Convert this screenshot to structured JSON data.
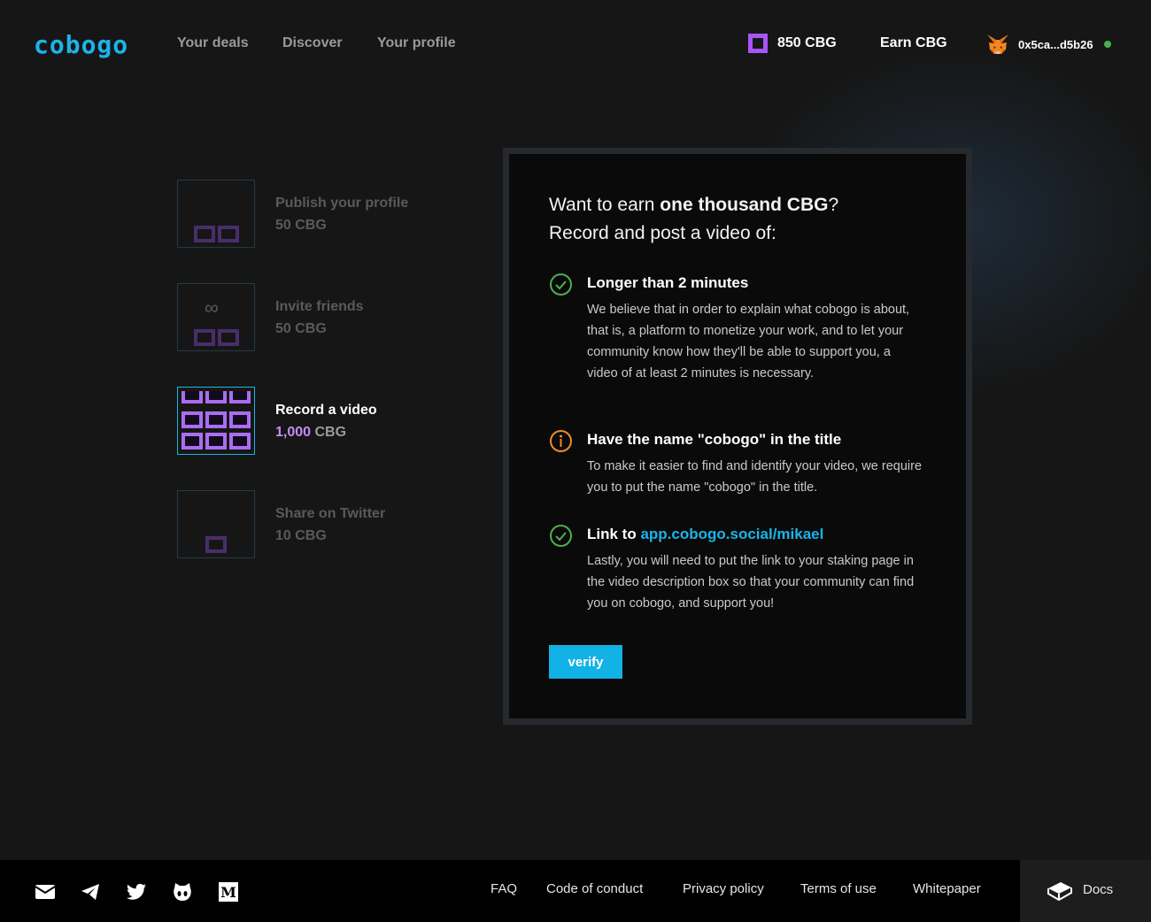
{
  "header": {
    "logo": "cobogo",
    "nav": [
      "Your deals",
      "Discover",
      "Your profile"
    ],
    "balance": "850 CBG",
    "earn": "Earn CBG",
    "wallet_address": "0x5ca...d5b26"
  },
  "steps": [
    {
      "title": "Publish your profile",
      "reward_num": "50",
      "reward_unit": "CBG",
      "active": false
    },
    {
      "title": "Invite friends",
      "reward_num": "50",
      "reward_unit": "CBG",
      "active": false
    },
    {
      "title": "Record a video",
      "reward_num": "1,000",
      "reward_unit": "CBG",
      "active": true
    },
    {
      "title": "Share on Twitter",
      "reward_num": "10",
      "reward_unit": "CBG",
      "active": false
    }
  ],
  "card": {
    "headline_prefix": "Want to earn ",
    "headline_bold": "one thousand CBG",
    "headline_suffix": "?",
    "headline_line2": "Record and post a video of:",
    "requirements": [
      {
        "status": "done",
        "title": "Longer than 2 minutes",
        "body": "We believe that in order to explain what cobogo is about, that is, a platform to monetize your work, and to let your community know how they'll be able to support you, a video of at least 2 minutes is necessary."
      },
      {
        "status": "info",
        "title": "Have the name \"cobogo\" in the title",
        "body": "To make it easier to find and identify your video, we require you to put the name \"cobogo\" in the title."
      },
      {
        "status": "done",
        "title_prefix": "Link to ",
        "link": "app.cobogo.social/mikael",
        "body": "Lastly, you will need to put the link to your staking page in the video description box so that your community can find you on cobogo, and support you!"
      }
    ],
    "verify_label": "verify"
  },
  "footer": {
    "social": [
      "mail-icon",
      "telegram-icon",
      "twitter-icon",
      "github-icon",
      "medium-icon"
    ],
    "links": [
      "FAQ",
      "Code of conduct",
      "Privacy policy",
      "Terms of use",
      "Whitepaper"
    ],
    "docs": "Docs"
  },
  "colors": {
    "accent": "#1ab4e8",
    "purple": "#a855f7",
    "success": "#4caf50",
    "warning": "#f08a2a"
  }
}
